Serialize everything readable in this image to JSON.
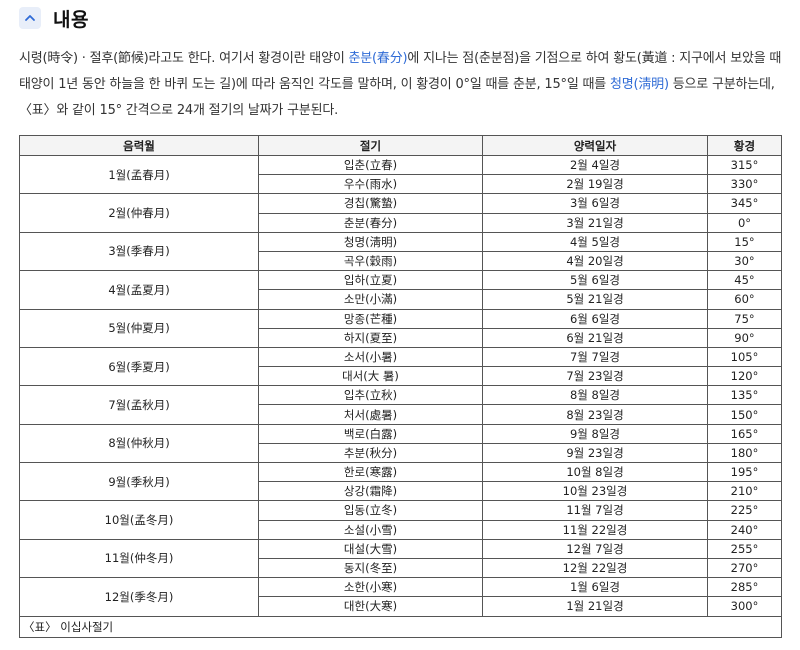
{
  "header": {
    "title": "내용"
  },
  "intro": {
    "t1": "시령(時令) · 절후(節候)라고도 한다. 여기서 황경이란 태양이 ",
    "link1": "춘분(春分)",
    "t2": "에 지나는 점(춘분점)을 기점으로 하여 황도(黃道 : 지구에서 보았을 때 태양이 1년 동안 하늘을 한 바퀴 도는 길)에 따라 움직인 각도를 말하며, 이 황경이 0°일 때를 춘분, 15°일 때를 ",
    "link2": "청명(淸明)",
    "t3": " 등으로 구분하는데, 〈표〉와 같이 15° 간격으로 24개 절기의 날짜가 구분된다."
  },
  "table": {
    "headers": [
      "음력월",
      "절기",
      "양력일자",
      "황경"
    ],
    "months": [
      {
        "month": "1월(孟春月)",
        "terms": [
          {
            "name": "입춘(立春)",
            "date": "2월 4일경",
            "deg": "315°"
          },
          {
            "name": "우수(雨水)",
            "date": "2월 19일경",
            "deg": "330°"
          }
        ]
      },
      {
        "month": "2월(仲春月)",
        "terms": [
          {
            "name": "경칩(驚蟄)",
            "date": "3월 6일경",
            "deg": "345°"
          },
          {
            "name": "춘분(春分)",
            "date": "3월 21일경",
            "deg": "0°"
          }
        ]
      },
      {
        "month": "3월(季春月)",
        "terms": [
          {
            "name": "청명(淸明)",
            "date": "4월 5일경",
            "deg": "15°"
          },
          {
            "name": "곡우(穀雨)",
            "date": "4월 20일경",
            "deg": "30°"
          }
        ]
      },
      {
        "month": "4월(孟夏月)",
        "terms": [
          {
            "name": "입하(立夏)",
            "date": "5월 6일경",
            "deg": "45°"
          },
          {
            "name": "소만(小滿)",
            "date": "5월 21일경",
            "deg": "60°"
          }
        ]
      },
      {
        "month": "5월(仲夏月)",
        "terms": [
          {
            "name": "망종(芒種)",
            "date": "6월 6일경",
            "deg": "75°"
          },
          {
            "name": "하지(夏至)",
            "date": "6월 21일경",
            "deg": "90°"
          }
        ]
      },
      {
        "month": "6월(季夏月)",
        "terms": [
          {
            "name": "소서(小暑)",
            "date": "7월 7일경",
            "deg": "105°"
          },
          {
            "name": "대서(大 暑)",
            "date": "7월 23일경",
            "deg": "120°"
          }
        ]
      },
      {
        "month": "7월(孟秋月)",
        "terms": [
          {
            "name": "입추(立秋)",
            "date": "8월 8일경",
            "deg": "135°"
          },
          {
            "name": "처서(處暑)",
            "date": "8월 23일경",
            "deg": "150°"
          }
        ]
      },
      {
        "month": "8월(仲秋月)",
        "terms": [
          {
            "name": "백로(白露)",
            "date": "9월 8일경",
            "deg": "165°"
          },
          {
            "name": "추분(秋分)",
            "date": "9월 23일경",
            "deg": "180°"
          }
        ]
      },
      {
        "month": "9월(季秋月)",
        "terms": [
          {
            "name": "한로(寒露)",
            "date": "10월 8일경",
            "deg": "195°"
          },
          {
            "name": "상강(霜降)",
            "date": "10월 23일경",
            "deg": "210°"
          }
        ]
      },
      {
        "month": "10월(孟冬月)",
        "terms": [
          {
            "name": "입동(立冬)",
            "date": "11월 7일경",
            "deg": "225°"
          },
          {
            "name": "소설(小雪)",
            "date": "11월 22일경",
            "deg": "240°"
          }
        ]
      },
      {
        "month": "11월(仲冬月)",
        "terms": [
          {
            "name": "대설(大雪)",
            "date": "12월 7일경",
            "deg": "255°"
          },
          {
            "name": "동지(冬至)",
            "date": "12월 22일경",
            "deg": "270°"
          }
        ]
      },
      {
        "month": "12월(季冬月)",
        "terms": [
          {
            "name": "소한(小寒)",
            "date": "1월 6일경",
            "deg": "285°"
          },
          {
            "name": "대한(大寒)",
            "date": "1월 21일경",
            "deg": "300°"
          }
        ]
      }
    ],
    "caption": "〈표〉 이십사절기"
  }
}
